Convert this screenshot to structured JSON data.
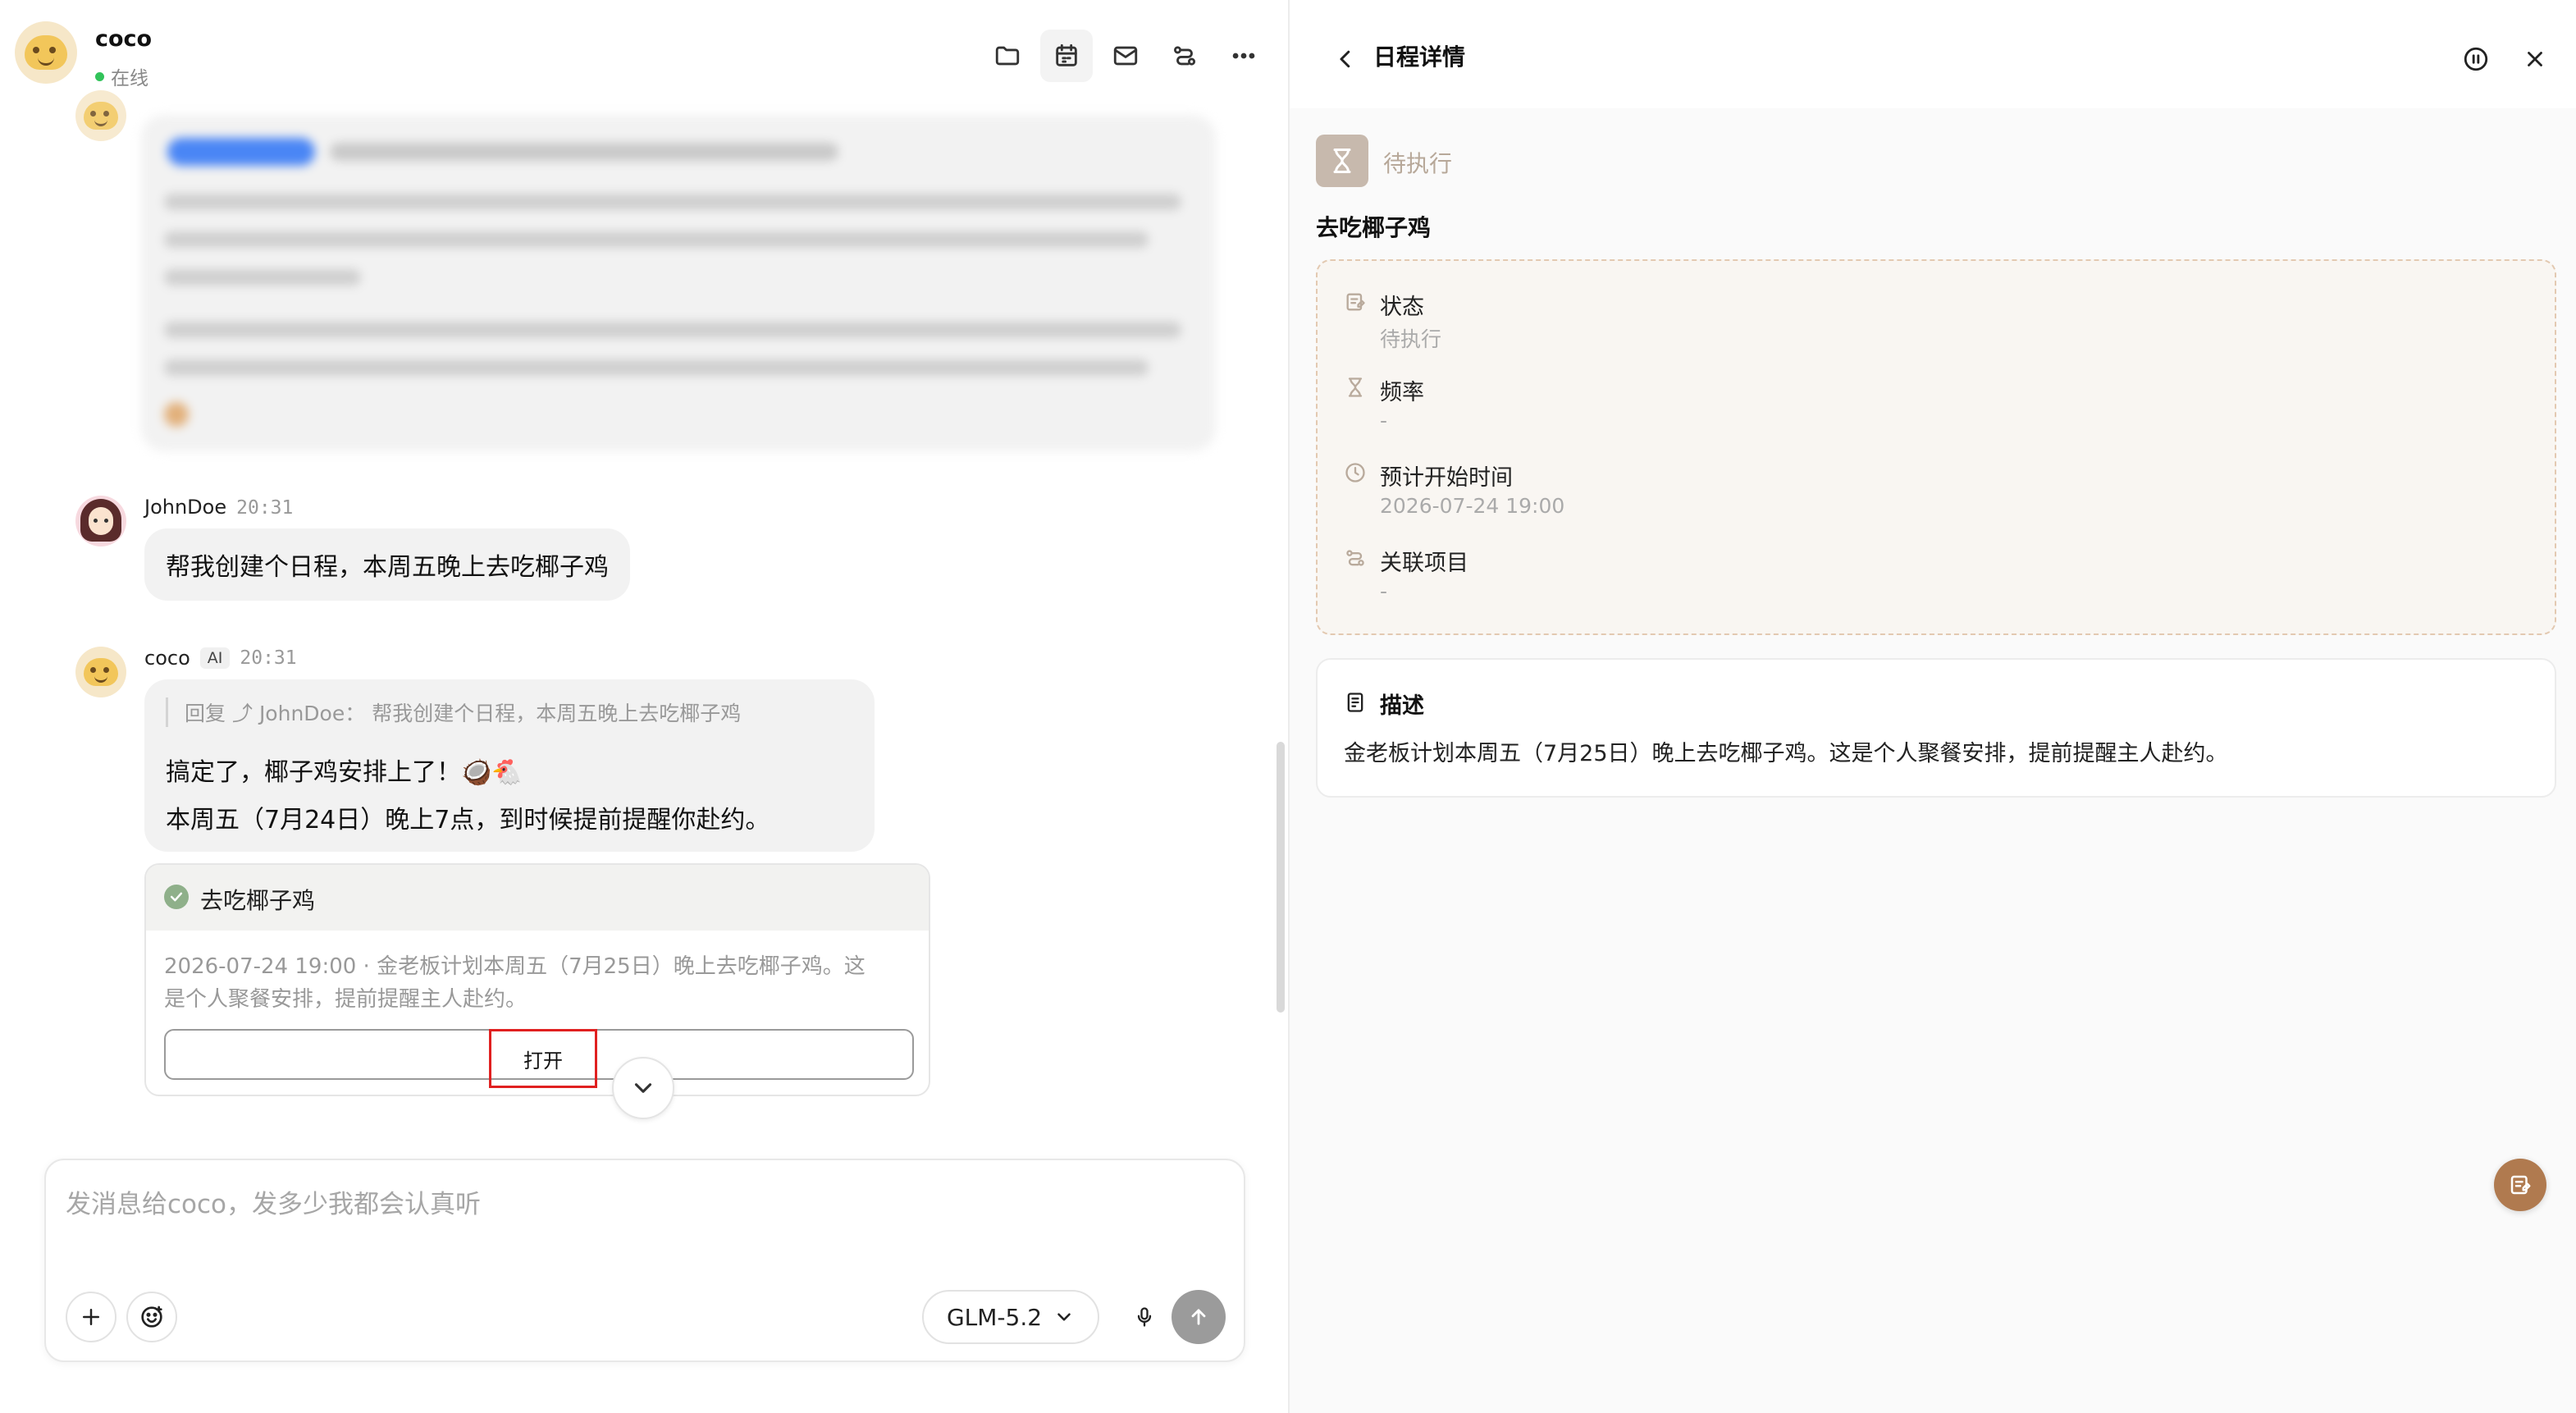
{
  "chat": {
    "header": {
      "name": "coco",
      "status": "在线"
    },
    "messages": [
      {
        "sender": "JohnDoe",
        "time": "20:31",
        "text": "帮我创建个日程，本周五晚上去吃椰子鸡"
      },
      {
        "sender": "coco",
        "badge": "AI",
        "time": "20:31",
        "quote_prefix": "回复",
        "quote_user": "JohnDoe：",
        "quote_text": "帮我创建个日程，本周五晚上去吃椰子鸡",
        "line1": "搞定了，椰子鸡安排上了！🥥🐔",
        "line2": "本周五（7月24日）晚上7点，到时候提前提醒你赴约。"
      }
    ],
    "card": {
      "title": "去吃椰子鸡",
      "detail_line1": "2026-07-24 19:00 · 金老板计划本周五（7月25日）晚上去吃椰子鸡。这",
      "detail_line2": "是个人聚餐安排，提前提醒主人赴约。",
      "open_button": "打开"
    },
    "composer": {
      "placeholder": "发消息给coco，发多少我都会认真听",
      "model": "GLM-5.2"
    }
  },
  "detail": {
    "header_title": "日程详情",
    "status_label": "待执行",
    "title": "去吃椰子鸡",
    "fields": [
      {
        "label": "状态",
        "value": "待执行",
        "icon": "edit-icon"
      },
      {
        "label": "频率",
        "value": "-",
        "icon": "hourglass-icon"
      },
      {
        "label": "预计开始时间",
        "value": "2026-07-24 19:00",
        "icon": "clock-icon"
      },
      {
        "label": "关联项目",
        "value": "-",
        "icon": "link-icon"
      }
    ],
    "description_label": "描述",
    "description_text": "金老板计划本周五（7月25日）晚上去吃椰子鸡。这是个人聚餐安排，提前提醒主人赴约。"
  },
  "colors": {
    "accent_brown": "#b07a4f",
    "status_gray_brown": "#c7b9ad",
    "highlight_red": "#e02020",
    "online_green": "#32c35a"
  }
}
